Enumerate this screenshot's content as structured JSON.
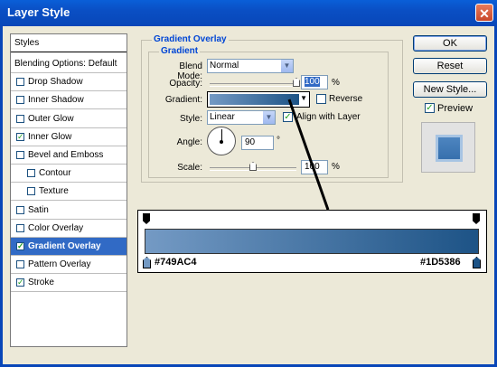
{
  "window": {
    "title": "Layer Style",
    "close_glyph": "✕"
  },
  "styles_list": [
    {
      "label": "Styles",
      "type": "header"
    },
    {
      "label": "Blending Options: Default",
      "type": "plain"
    },
    {
      "label": "Drop Shadow",
      "checked": false
    },
    {
      "label": "Inner Shadow",
      "checked": false
    },
    {
      "label": "Outer Glow",
      "checked": false
    },
    {
      "label": "Inner Glow",
      "checked": true
    },
    {
      "label": "Bevel and Emboss",
      "checked": false
    },
    {
      "label": "Contour",
      "checked": false,
      "indent": true
    },
    {
      "label": "Texture",
      "checked": false,
      "indent": true
    },
    {
      "label": "Satin",
      "checked": false
    },
    {
      "label": "Color Overlay",
      "checked": false
    },
    {
      "label": "Gradient Overlay",
      "checked": true,
      "selected": true
    },
    {
      "label": "Pattern Overlay",
      "checked": false
    },
    {
      "label": "Stroke",
      "checked": true
    }
  ],
  "gradient_overlay": {
    "section_title": "Gradient Overlay",
    "group_title": "Gradient",
    "blend_mode_label": "Blend Mode:",
    "blend_mode_value": "Normal",
    "opacity_label": "Opacity:",
    "opacity_value": "100",
    "opacity_unit": "%",
    "opacity_level": 1.0,
    "gradient_label": "Gradient:",
    "reverse_label": "Reverse",
    "reverse_checked": false,
    "style_label": "Style:",
    "style_value": "Linear",
    "align_label": "Align with Layer",
    "align_checked": true,
    "angle_label": "Angle:",
    "angle_value": "90",
    "angle_unit": "°",
    "scale_label": "Scale:",
    "scale_value": "100",
    "scale_unit": "%",
    "scale_level": 0.5
  },
  "buttons": {
    "ok": "OK",
    "reset": "Reset",
    "new_style": "New Style...",
    "preview_label": "Preview",
    "preview_checked": true
  },
  "gradient_editor": {
    "left_color": "#749AC4",
    "right_color": "#1D5386"
  },
  "colors": {
    "title_bar": "#0a4fc4",
    "selected_row": "#316ac5",
    "group_title": "#0046d5",
    "gradient_start": "#749AC4",
    "gradient_end": "#1D5386"
  }
}
